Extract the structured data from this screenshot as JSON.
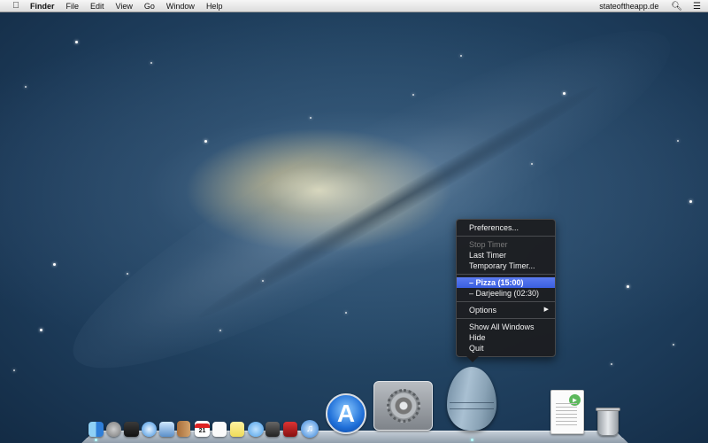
{
  "menubar": {
    "app_name": "Finder",
    "items": [
      "File",
      "Edit",
      "View",
      "Go",
      "Window",
      "Help"
    ],
    "right_text": "stateoftheapp.de",
    "icons": [
      "apple-icon",
      "spotlight-search-icon",
      "notification-center-icon"
    ]
  },
  "context_menu": {
    "preferences": "Preferences...",
    "stop_timer": "Stop Timer",
    "last_timer": "Last Timer",
    "temporary_timer": "Temporary Timer...",
    "timers": [
      {
        "label": "– Pizza (15:00)",
        "highlighted": true
      },
      {
        "label": "– Darjeeling (02:30)",
        "highlighted": false
      }
    ],
    "options": "Options",
    "show_all_windows": "Show All Windows",
    "hide": "Hide",
    "quit": "Quit"
  },
  "dock": {
    "calendar_day": "21",
    "icons": [
      "finder-icon",
      "launchpad-icon",
      "mission-control-icon",
      "safari-icon",
      "preview-icon",
      "contacts-icon",
      "calendar-icon",
      "reminders-icon",
      "notes-icon",
      "messages-icon",
      "facetime-icon",
      "photo-booth-icon",
      "itunes-icon",
      "app-store-icon",
      "system-preferences-icon",
      "egg-timer-icon",
      "document-icon",
      "trash-icon"
    ]
  },
  "colors": {
    "menu_highlight": "#3a5fe0",
    "menu_background": "#1c1c1e",
    "wallpaper_deep": "#0c2036"
  }
}
